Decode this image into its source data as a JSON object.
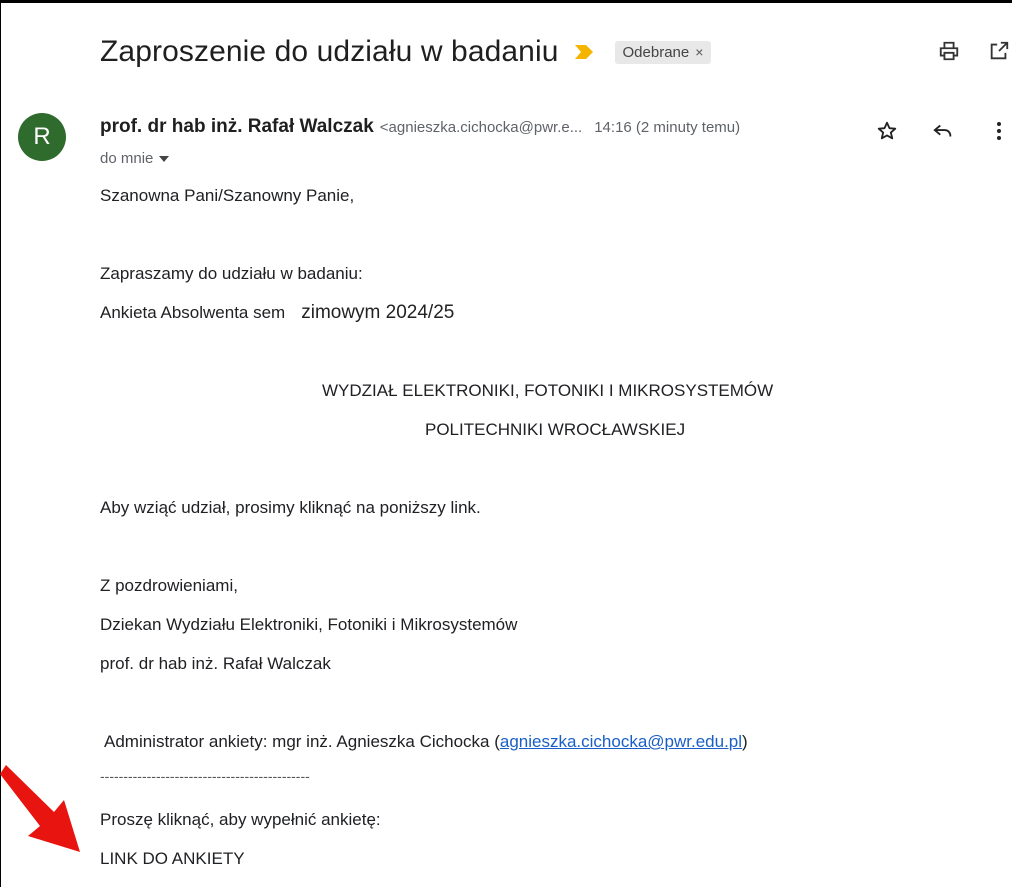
{
  "email": {
    "subject": "Zaproszenie do udziału w badaniu",
    "label": "Odebrane",
    "label_close": "×",
    "avatar_letter": "R",
    "sender_name": "prof. dr hab inż. Rafał Walczak",
    "sender_email": "<agnieszka.cichocka@pwr.e...",
    "time": "14:16 (2 minuty temu)",
    "to": "do mnie",
    "body": {
      "greeting": "Szanowna Pani/Szanowny Panie,",
      "invite": "Zapraszamy do udziału w badaniu:",
      "survey_name": "Ankieta Absolwenta sem",
      "survey_term": "zimowym 2024/25",
      "faculty_line1": "WYDZIAŁ ELEKTRONIKI, FOTONIKI I MIKROSYSTEMÓW",
      "faculty_line2": "POLITECHNIKI WROCŁAWSKIEJ",
      "instruction": "Aby wziąć udział, prosimy kliknąć na poniższy link.",
      "closing": "Z pozdrowieniami,",
      "signature_title": "Dziekan Wydziału Elektroniki, Fotoniki i Mikrosystemów",
      "signature_name": "prof. dr hab inż. Rafał Walczak",
      "admin_prefix": "Administrator ankiety: mgr inż. Agnieszka Cichocka (",
      "admin_email": "agnieszka.cichocka@pwr.edu.pl",
      "admin_suffix": ")",
      "separator": "---------------------------------------------",
      "click_prompt": "Proszę kliknąć, aby wypełnić ankietę:",
      "survey_link": "LINK DO ANKIETY"
    }
  },
  "colors": {
    "avatar": "#2e6b2c",
    "important_marker": "#f4b400",
    "link": "#1a5fc7",
    "arrow": "#e8140f"
  },
  "icons": [
    "important-marker-icon",
    "print-icon",
    "open-in-new-window-icon",
    "star-icon",
    "reply-icon",
    "more-vert-icon",
    "chevron-down-icon",
    "red-arrow-icon"
  ]
}
